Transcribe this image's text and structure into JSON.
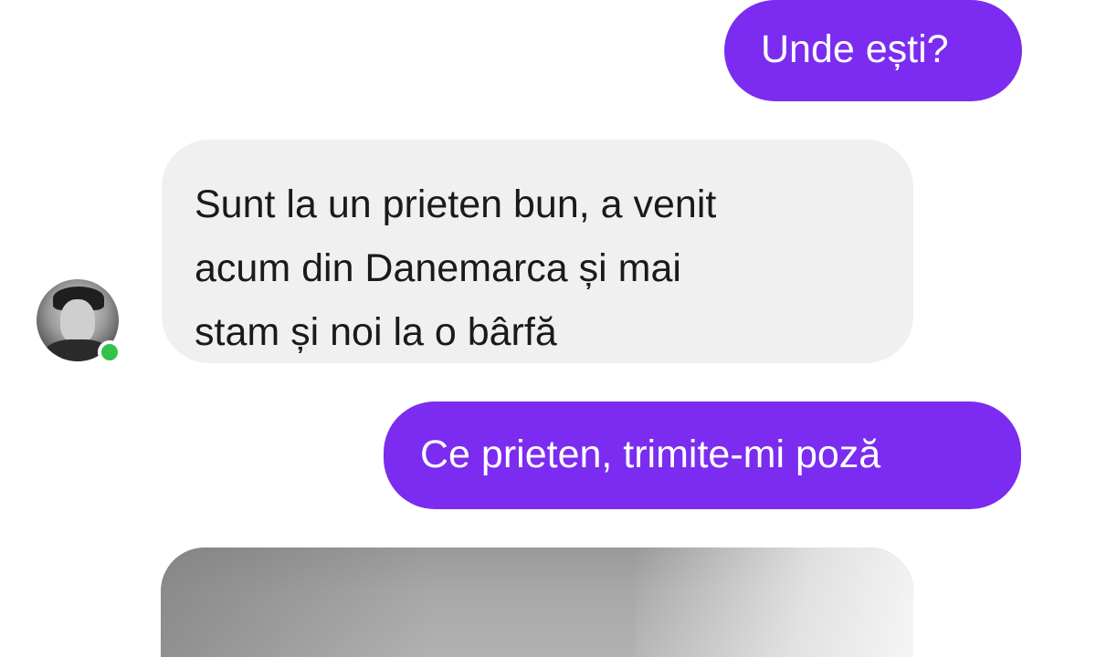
{
  "conversation": {
    "messages": [
      {
        "direction": "sent",
        "text": "Unde ești?"
      },
      {
        "direction": "received",
        "lines": [
          "Sunt la un prieten bun, a venit",
          "acum din Danemarca și mai",
          "stam și noi la o bârfă"
        ]
      },
      {
        "direction": "sent",
        "text": "Ce prieten, trimite-mi poză"
      },
      {
        "direction": "received",
        "type": "photo"
      }
    ],
    "contact": {
      "avatar_icon": "user-avatar-icon",
      "online": true,
      "online_color": "#31c24a"
    }
  },
  "colors": {
    "sent_bubble": "#7b2cf0",
    "received_bubble": "#f0f0f0"
  }
}
